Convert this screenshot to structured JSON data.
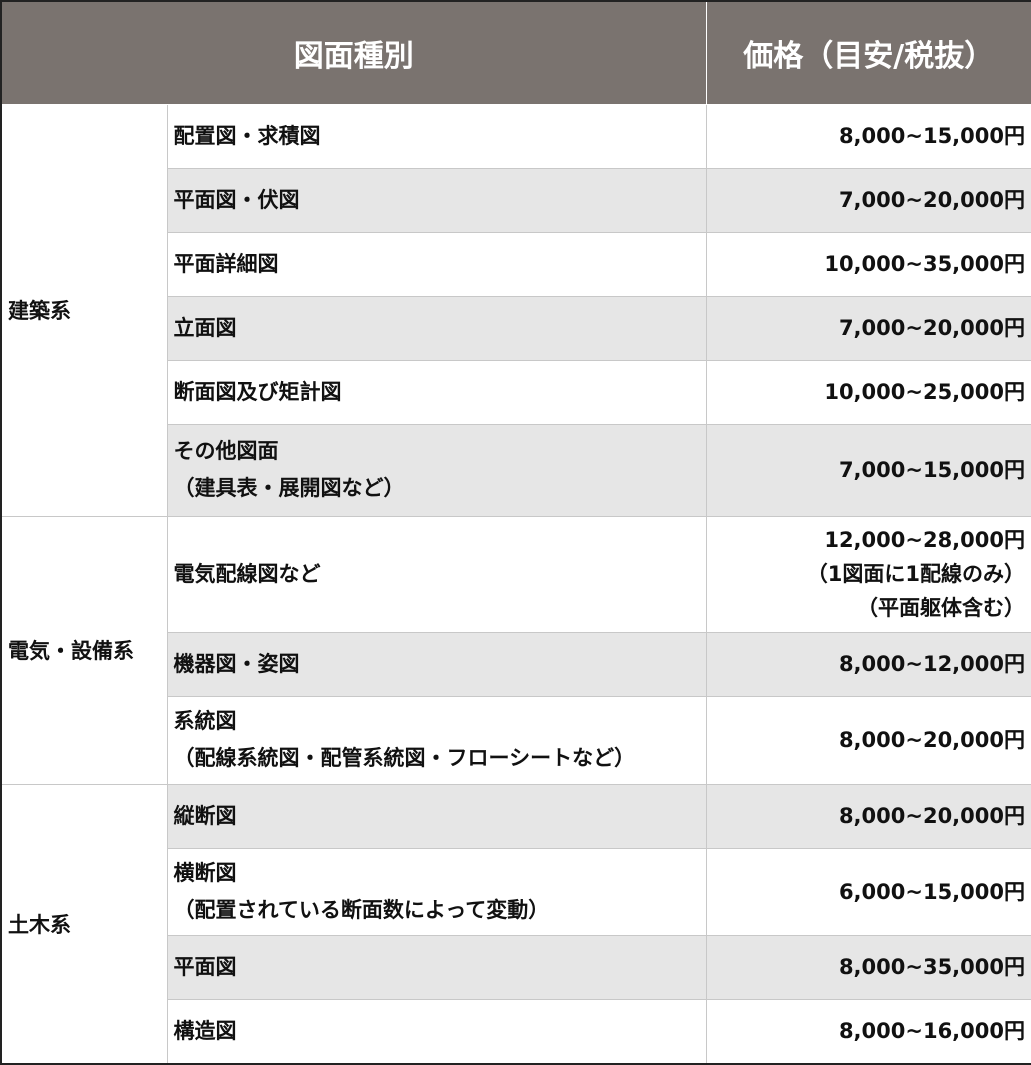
{
  "headers": {
    "type": "図面種別",
    "price": "価格（目安/税抜）"
  },
  "categories": {
    "architecture": "建築系",
    "electrical": "電気・設備系",
    "civil": "土木系"
  },
  "rows": [
    {
      "name": [
        "配置図・求積図"
      ],
      "price": [
        "8,000~15,000円"
      ]
    },
    {
      "name": [
        "平面図・伏図"
      ],
      "price": [
        "7,000~20,000円"
      ]
    },
    {
      "name": [
        "平面詳細図"
      ],
      "price": [
        "10,000~35,000円"
      ]
    },
    {
      "name": [
        "立面図"
      ],
      "price": [
        "7,000~20,000円"
      ]
    },
    {
      "name": [
        "断面図及び矩計図"
      ],
      "price": [
        "10,000~25,000円"
      ]
    },
    {
      "name": [
        "その他図面",
        "（建具表・展開図など）"
      ],
      "price": [
        "7,000~15,000円"
      ]
    },
    {
      "name": [
        "電気配線図など"
      ],
      "price": [
        "12,000~28,000円",
        "（1図面に1配線のみ）",
        "（平面躯体含む）"
      ]
    },
    {
      "name": [
        "機器図・姿図"
      ],
      "price": [
        "8,000~12,000円"
      ]
    },
    {
      "name": [
        "系統図",
        "（配線系統図・配管系統図・フローシートなど）"
      ],
      "price": [
        "8,000~20,000円"
      ]
    },
    {
      "name": [
        "縦断図"
      ],
      "price": [
        "8,000~20,000円"
      ]
    },
    {
      "name": [
        "横断図",
        "（配置されている断面数によって変動）"
      ],
      "price": [
        "6,000~15,000円"
      ]
    },
    {
      "name": [
        "平面図"
      ],
      "price": [
        "8,000~35,000円"
      ]
    },
    {
      "name": [
        "構造図"
      ],
      "price": [
        "8,000~16,000円"
      ]
    }
  ],
  "colors": {
    "header_bg": "#7a736f",
    "row_shade": "#e6e6e6"
  }
}
